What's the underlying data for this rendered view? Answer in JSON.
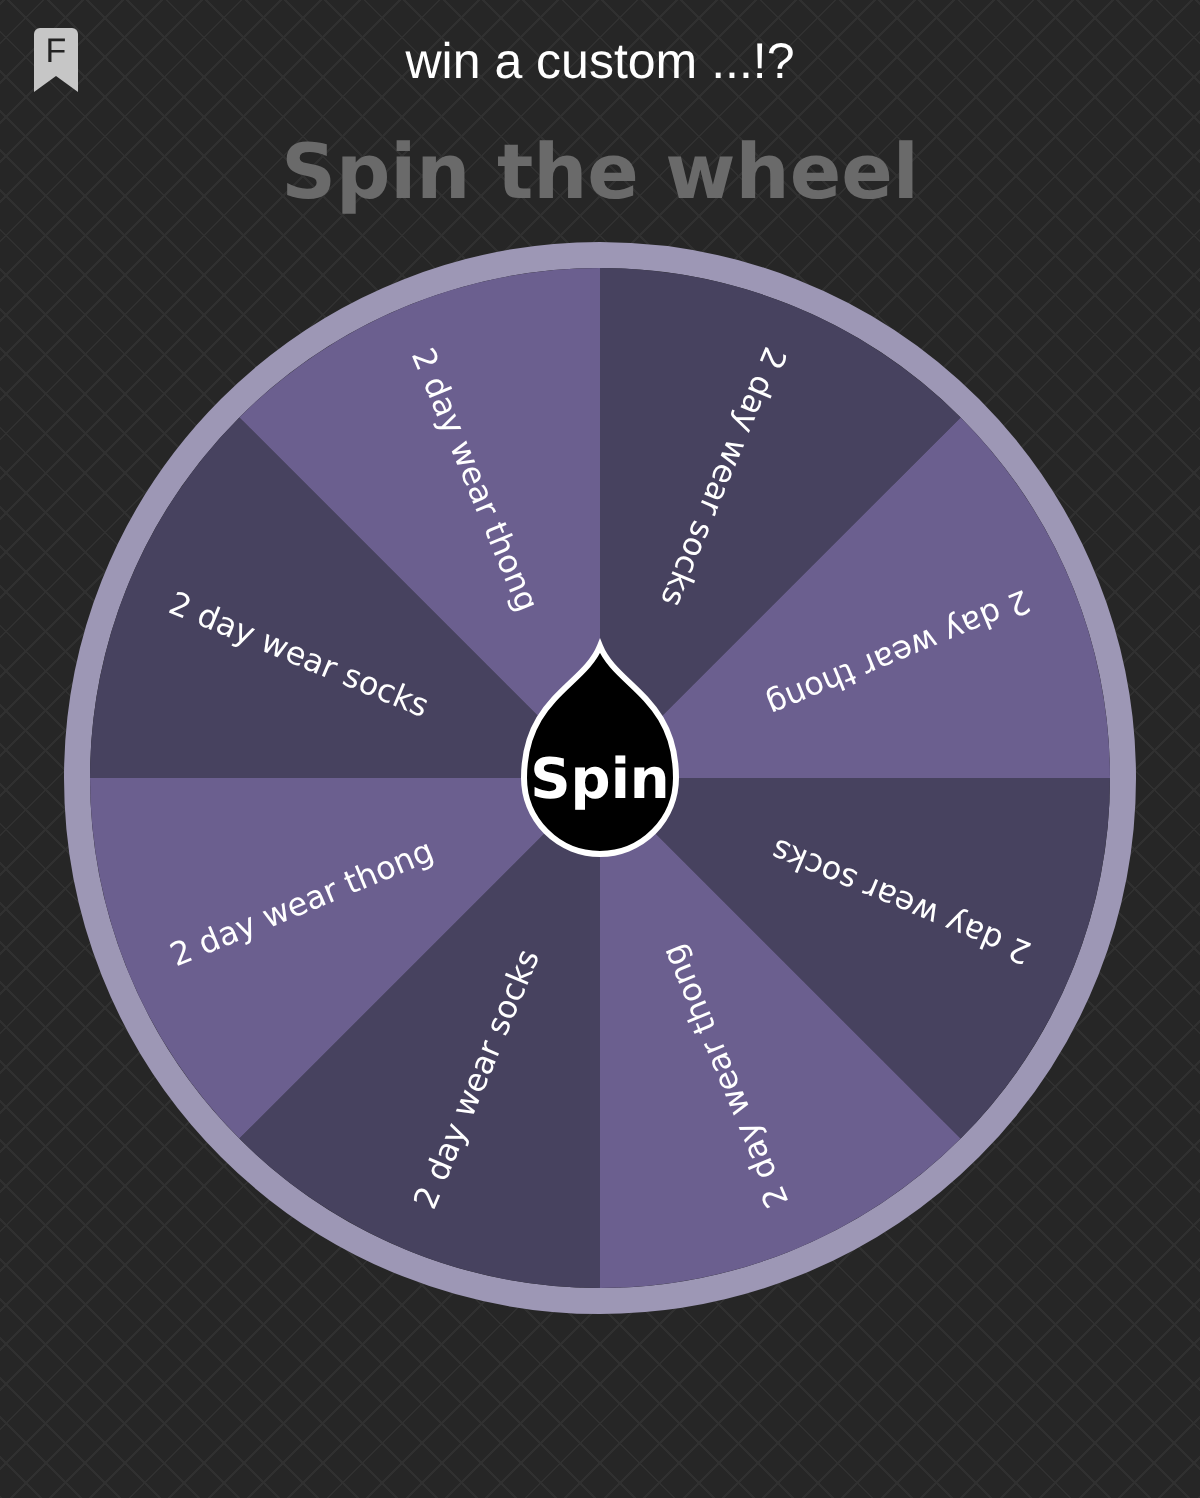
{
  "header": {
    "badge": "F",
    "title": "win a custom ...!?"
  },
  "heading": "Spin the wheel",
  "wheel": {
    "segments": [
      {
        "label": "2 day wear socks",
        "color": "#47425f"
      },
      {
        "label": "2 day wear thong",
        "color": "#6b5f8f"
      },
      {
        "label": "2 day wear socks",
        "color": "#47425f"
      },
      {
        "label": "2 day wear thong",
        "color": "#6b5f8f"
      },
      {
        "label": "2 day wear socks",
        "color": "#47425f"
      },
      {
        "label": "2 day wear thong",
        "color": "#6b5f8f"
      },
      {
        "label": "2 day wear socks",
        "color": "#47425f"
      },
      {
        "label": "2 day wear thong",
        "color": "#6b5f8f"
      }
    ],
    "spin_button": "Spin"
  }
}
